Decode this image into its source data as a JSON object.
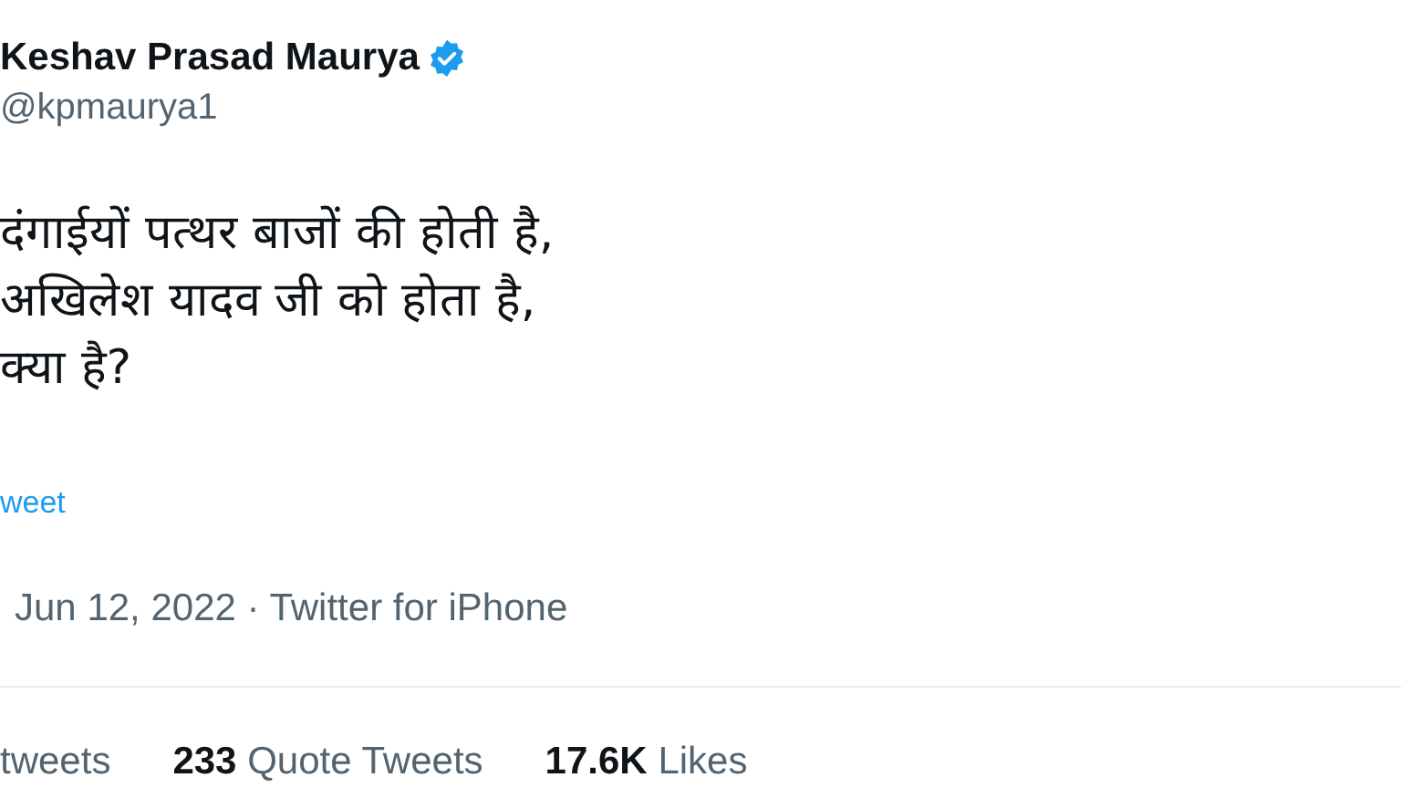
{
  "author": {
    "name": "Keshav Prasad Maurya",
    "verified": true,
    "handle": "@kpmaurya1"
  },
  "tweet_lines": [
    "दंगाईयों पत्थर बाजों की होती है,",
    "अखिलेश यादव जी को होता है,",
    "क्या है?"
  ],
  "translate_link": "weet",
  "meta": "Jun 12, 2022 · Twitter for iPhone",
  "stats": [
    {
      "label": "tweets"
    },
    {
      "count": "233",
      "label": "Quote Tweets"
    },
    {
      "count": "17.6K",
      "label": "Likes"
    }
  ]
}
